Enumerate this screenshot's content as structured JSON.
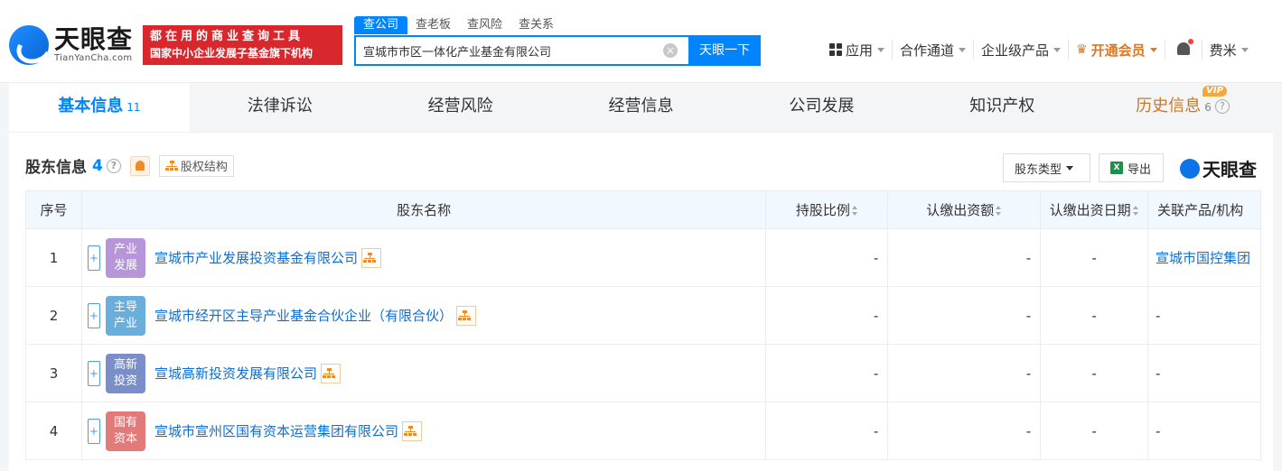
{
  "header": {
    "logo_cn": "天眼查",
    "logo_en": "TianYanCha.com",
    "slogan_line1": "都在用的商业查询工具",
    "slogan_line2": "国家中小企业发展子基金旗下机构",
    "search_tabs": [
      "查公司",
      "查老板",
      "查风险",
      "查关系"
    ],
    "search_value": "宣城市市区一体化产业基金有限公司",
    "search_button": "天眼一下",
    "nav": {
      "apps": "应用",
      "channel": "合作通道",
      "enterprise": "企业级产品",
      "vip": "开通会员",
      "user": "费米"
    }
  },
  "tabs": [
    {
      "label": "基本信息",
      "count": "11"
    },
    {
      "label": "法律诉讼",
      "count": ""
    },
    {
      "label": "经营风险",
      "count": ""
    },
    {
      "label": "经营信息",
      "count": ""
    },
    {
      "label": "公司发展",
      "count": ""
    },
    {
      "label": "知识产权",
      "count": ""
    },
    {
      "label": "历史信息",
      "count": "6",
      "badge": "VIP"
    }
  ],
  "section": {
    "title": "股东信息",
    "count": "4",
    "structure_button": "股权结构",
    "type_dropdown": "股东类型",
    "export_button": "导出",
    "brand": "天眼查"
  },
  "table": {
    "headers": [
      "序号",
      "股东名称",
      "持股比例",
      "认缴出资额",
      "认缴出资日期",
      "关联产品/机构"
    ],
    "rows": [
      {
        "idx": "1",
        "tag1": "产业",
        "tag2": "发展",
        "tag_color": "#b696d8",
        "name": "宣城市产业发展投资基金有限公司",
        "ratio": "-",
        "amount": "-",
        "date": "-",
        "related": "宣城市国控集团"
      },
      {
        "idx": "2",
        "tag1": "主导",
        "tag2": "产业",
        "tag_color": "#6aaedb",
        "name": "宣城市经开区主导产业基金合伙企业（有限合伙）",
        "ratio": "-",
        "amount": "-",
        "date": "-",
        "related": "-"
      },
      {
        "idx": "3",
        "tag1": "高新",
        "tag2": "投资",
        "tag_color": "#7a8fc7",
        "name": "宣城高新投资发展有限公司",
        "ratio": "-",
        "amount": "-",
        "date": "-",
        "related": "-"
      },
      {
        "idx": "4",
        "tag1": "国有",
        "tag2": "资本",
        "tag_color": "#e27a7a",
        "name": "宣城市宣州区国有资本运营集团有限公司",
        "ratio": "-",
        "amount": "-",
        "date": "-",
        "related": "-"
      }
    ]
  }
}
